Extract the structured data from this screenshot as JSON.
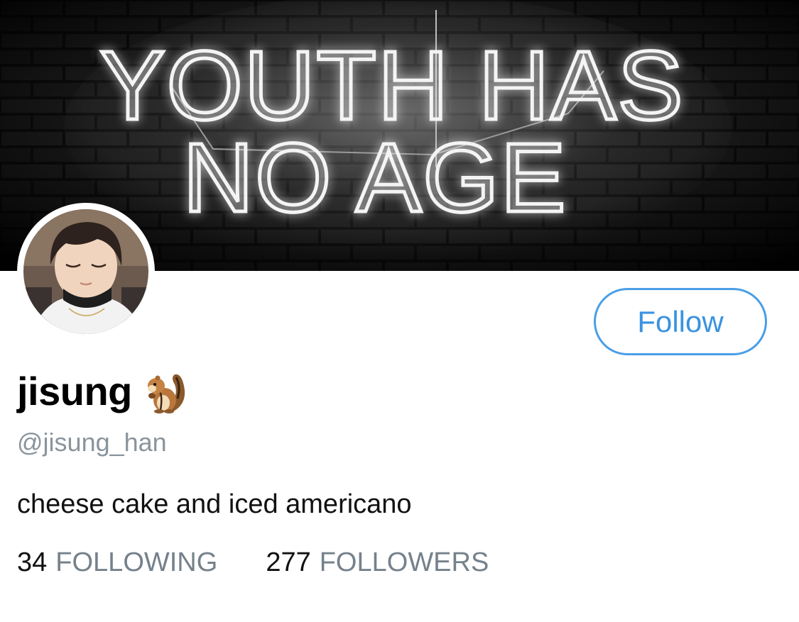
{
  "banner": {
    "neon_line1": "YOUTH HAS",
    "neon_line2": "NO AGE"
  },
  "profile": {
    "display_name": "jisung",
    "name_emoji": "chipmunk-icon",
    "handle": "@jisung_han",
    "bio": "cheese cake and iced americano"
  },
  "actions": {
    "follow_label": "Follow"
  },
  "stats": {
    "following_count": "34",
    "following_label": "FOLLOWING",
    "followers_count": "277",
    "followers_label": "FOLLOWERS"
  },
  "colors": {
    "accent": "#4a9ee6",
    "muted_text": "#75818b",
    "banner_bg": "#050505"
  }
}
